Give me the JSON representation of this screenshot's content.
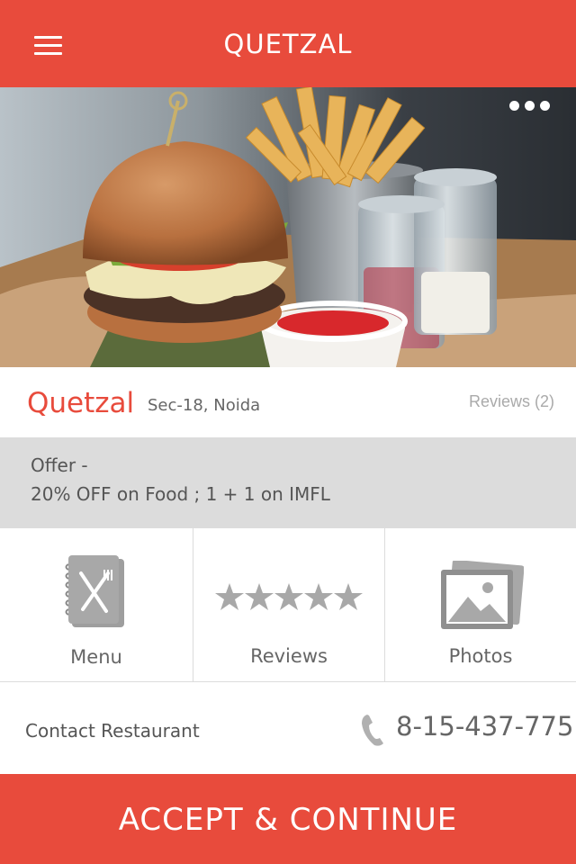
{
  "header": {
    "title": "QUETZAL",
    "menu_icon": "hamburger-menu-icon"
  },
  "hero": {
    "more_icon": "more-dots-icon"
  },
  "restaurant": {
    "name": "Quetzal",
    "location": "Sec-18, Noida",
    "reviews_link": "Reviews (2)"
  },
  "offer": {
    "line1": "Offer -",
    "line2": "20% OFF on Food ; 1 + 1 on IMFL"
  },
  "actions": [
    {
      "label": "Menu",
      "icon": "menu-book-icon"
    },
    {
      "label": "Reviews",
      "icon": "star-rating-icon"
    },
    {
      "label": "Photos",
      "icon": "photos-icon"
    }
  ],
  "contact": {
    "label": "Contact Restaurant",
    "phone": "8-15-437-775",
    "phone_icon": "phone-icon"
  },
  "cta": {
    "label": "ACCEPT & CONTINUE"
  },
  "colors": {
    "brand": "#e84b3c",
    "offer_bg": "#dcdcdc",
    "icon_gray": "#9e9e9e"
  }
}
